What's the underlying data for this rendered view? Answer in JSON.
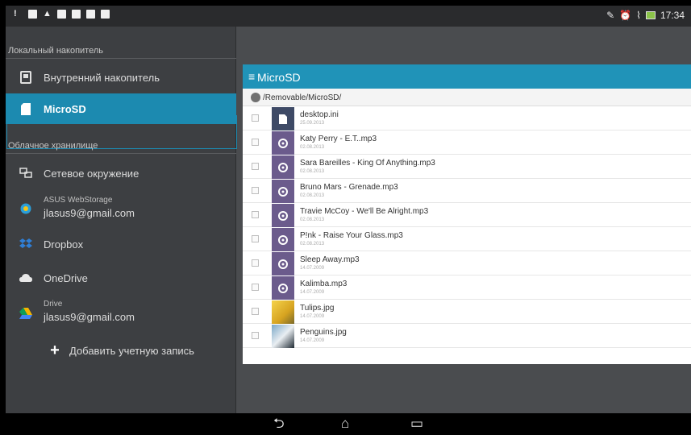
{
  "status_bar": {
    "left_icons": [
      "alert-icon",
      "gallery-icon",
      "warning-icon",
      "image-icon",
      "document-icon",
      "photo-icon",
      "camera-icon"
    ],
    "right_icons": [
      "mute-icon",
      "alarm-icon",
      "wifi-icon",
      "battery-icon"
    ],
    "time": "17:34"
  },
  "drawer": {
    "local_header": "Локальный накопитель",
    "items": [
      {
        "label": "Внутренний накопитель",
        "icon": "phone-storage-icon"
      },
      {
        "label": "MicroSD",
        "icon": "sd-card-icon"
      }
    ],
    "cloud_header": "Облачное хранилище",
    "network": {
      "label": "Сетевое окружение",
      "icon": "network-icon"
    },
    "asus": {
      "title": "ASUS WebStorage",
      "account": "jlasus9@gmail.com",
      "icon": "asus-webstorage-icon"
    },
    "dropbox": {
      "label": "Dropbox",
      "icon": "dropbox-icon"
    },
    "onedrive": {
      "label": "OneDrive",
      "icon": "onedrive-icon"
    },
    "drive": {
      "title": "Drive",
      "account": "jlasus9@gmail.com",
      "icon": "google-drive-icon"
    },
    "add_account": {
      "label": "Добавить учетную запись",
      "icon": "plus-icon"
    }
  },
  "pane": {
    "title": "MicroSD",
    "menu_icon": "≡",
    "path": "/Removable/MicroSD/",
    "files": [
      {
        "name": "desktop.ini",
        "date": "25.09.2013",
        "type": "doc"
      },
      {
        "name": "Katy Perry - E.T..mp3",
        "date": "02.08.2013",
        "type": "audio"
      },
      {
        "name": "Sara Bareilles - King Of Anything.mp3",
        "date": "02.08.2013",
        "type": "audio"
      },
      {
        "name": "Bruno Mars - Grenade.mp3",
        "date": "02.08.2013",
        "type": "audio"
      },
      {
        "name": "Travie McCoy - We'll Be Alright.mp3",
        "date": "02.08.2013",
        "type": "audio"
      },
      {
        "name": "P!nk - Raise Your Glass.mp3",
        "date": "02.08.2013",
        "type": "audio"
      },
      {
        "name": "Sleep Away.mp3",
        "date": "14.07.2009",
        "type": "audio"
      },
      {
        "name": "Kalimba.mp3",
        "date": "14.07.2009",
        "type": "audio"
      },
      {
        "name": "Tulips.jpg",
        "date": "14.07.2009",
        "type": "img-tulips"
      },
      {
        "name": "Penguins.jpg",
        "date": "14.07.2009",
        "type": "img-penguins"
      }
    ]
  },
  "navbar": {
    "back": "⮌",
    "home": "⌂",
    "recents": "▭"
  },
  "colors": {
    "accent": "#2093b8",
    "active_item": "#1c8ab0",
    "drawer_bg": "#3d3f42"
  }
}
